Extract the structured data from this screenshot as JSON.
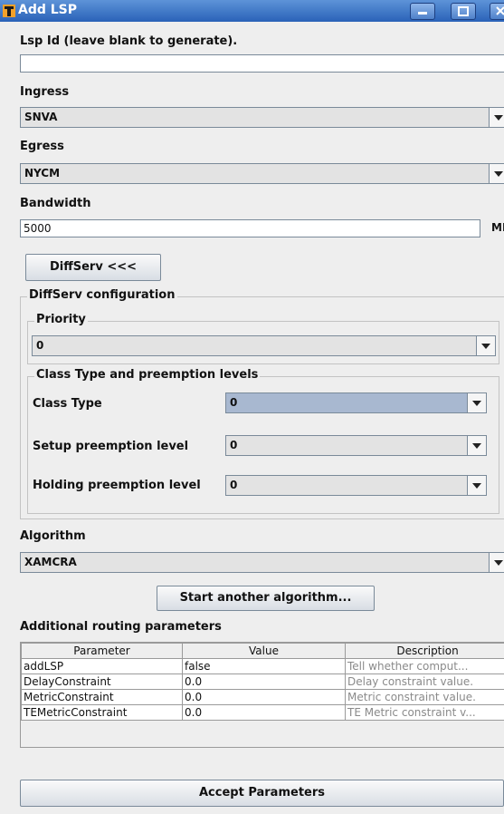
{
  "window": {
    "title": "Add LSP"
  },
  "lsp_id": {
    "label": "Lsp Id (leave blank to generate).",
    "value": ""
  },
  "ingress": {
    "label": "Ingress",
    "value": "SNVA"
  },
  "egress": {
    "label": "Egress",
    "value": "NYCM"
  },
  "bandwidth": {
    "label": "Bandwidth",
    "value": "5000",
    "unit": "MBPS"
  },
  "diffserv_toggle": {
    "label": "DiffServ <<<"
  },
  "diffserv": {
    "group_title": "DiffServ configuration",
    "priority": {
      "title": "Priority",
      "value": "0"
    },
    "class_group": {
      "title": "Class Type and preemption levels",
      "class_type": {
        "label": "Class Type",
        "value": "0"
      },
      "setup": {
        "label": "Setup preemption level",
        "value": "0"
      },
      "holding": {
        "label": "Holding preemption level",
        "value": "0"
      }
    }
  },
  "algorithm": {
    "label": "Algorithm",
    "value": "XAMCRA",
    "start_button": "Start another algorithm..."
  },
  "routing": {
    "title": "Additional routing parameters",
    "columns": [
      "Parameter",
      "Value",
      "Description"
    ],
    "rows": [
      {
        "param": "addLSP",
        "value": "false",
        "desc": "Tell whether comput..."
      },
      {
        "param": "DelayConstraint",
        "value": "0.0",
        "desc": "Delay constraint value."
      },
      {
        "param": "MetricConstraint",
        "value": "0.0",
        "desc": "Metric constraint value."
      },
      {
        "param": "TEMetricConstraint",
        "value": "0.0",
        "desc": "TE Metric constraint v..."
      }
    ]
  },
  "accept_button": "Accept Parameters"
}
